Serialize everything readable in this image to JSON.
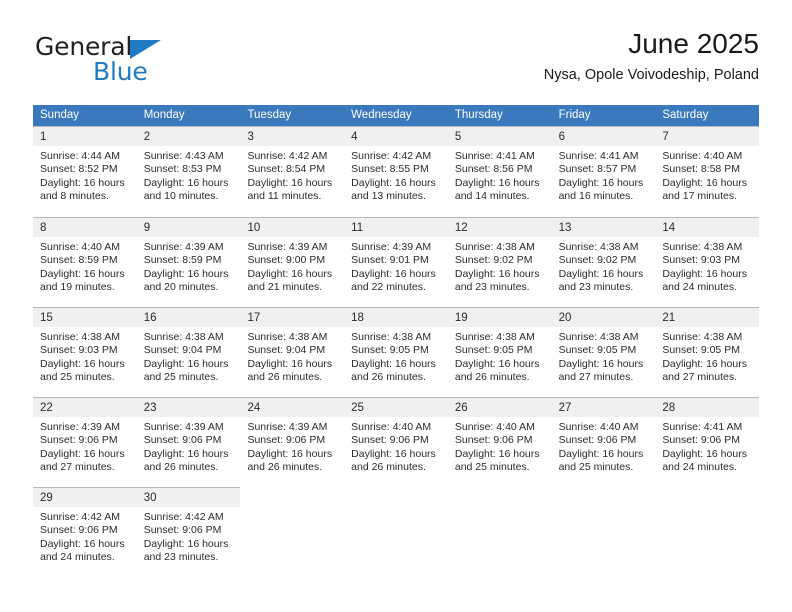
{
  "brand": {
    "name_part1": "General",
    "name_part2": "Blue",
    "triangle_color": "#1f7cc4"
  },
  "header": {
    "title": "June 2025",
    "subtitle": "Nysa, Opole Voivodeship, Poland"
  },
  "theme": {
    "header_blue": "#3a79bd",
    "day_band_gray": "#f0f0f0",
    "grid_line": "#b9b9b9",
    "text": "#2b2b2b"
  },
  "weekdays": [
    "Sunday",
    "Monday",
    "Tuesday",
    "Wednesday",
    "Thursday",
    "Friday",
    "Saturday"
  ],
  "labels": {
    "sunrise_prefix": "Sunrise:",
    "sunset_prefix": "Sunset:",
    "daylight_prefix": "Daylight:"
  },
  "weeks": [
    [
      {
        "day": "1",
        "sunrise": "Sunrise: 4:44 AM",
        "sunset": "Sunset: 8:52 PM",
        "daylight_1": "Daylight: 16 hours",
        "daylight_2": "and 8 minutes."
      },
      {
        "day": "2",
        "sunrise": "Sunrise: 4:43 AM",
        "sunset": "Sunset: 8:53 PM",
        "daylight_1": "Daylight: 16 hours",
        "daylight_2": "and 10 minutes."
      },
      {
        "day": "3",
        "sunrise": "Sunrise: 4:42 AM",
        "sunset": "Sunset: 8:54 PM",
        "daylight_1": "Daylight: 16 hours",
        "daylight_2": "and 11 minutes."
      },
      {
        "day": "4",
        "sunrise": "Sunrise: 4:42 AM",
        "sunset": "Sunset: 8:55 PM",
        "daylight_1": "Daylight: 16 hours",
        "daylight_2": "and 13 minutes."
      },
      {
        "day": "5",
        "sunrise": "Sunrise: 4:41 AM",
        "sunset": "Sunset: 8:56 PM",
        "daylight_1": "Daylight: 16 hours",
        "daylight_2": "and 14 minutes."
      },
      {
        "day": "6",
        "sunrise": "Sunrise: 4:41 AM",
        "sunset": "Sunset: 8:57 PM",
        "daylight_1": "Daylight: 16 hours",
        "daylight_2": "and 16 minutes."
      },
      {
        "day": "7",
        "sunrise": "Sunrise: 4:40 AM",
        "sunset": "Sunset: 8:58 PM",
        "daylight_1": "Daylight: 16 hours",
        "daylight_2": "and 17 minutes."
      }
    ],
    [
      {
        "day": "8",
        "sunrise": "Sunrise: 4:40 AM",
        "sunset": "Sunset: 8:59 PM",
        "daylight_1": "Daylight: 16 hours",
        "daylight_2": "and 19 minutes."
      },
      {
        "day": "9",
        "sunrise": "Sunrise: 4:39 AM",
        "sunset": "Sunset: 8:59 PM",
        "daylight_1": "Daylight: 16 hours",
        "daylight_2": "and 20 minutes."
      },
      {
        "day": "10",
        "sunrise": "Sunrise: 4:39 AM",
        "sunset": "Sunset: 9:00 PM",
        "daylight_1": "Daylight: 16 hours",
        "daylight_2": "and 21 minutes."
      },
      {
        "day": "11",
        "sunrise": "Sunrise: 4:39 AM",
        "sunset": "Sunset: 9:01 PM",
        "daylight_1": "Daylight: 16 hours",
        "daylight_2": "and 22 minutes."
      },
      {
        "day": "12",
        "sunrise": "Sunrise: 4:38 AM",
        "sunset": "Sunset: 9:02 PM",
        "daylight_1": "Daylight: 16 hours",
        "daylight_2": "and 23 minutes."
      },
      {
        "day": "13",
        "sunrise": "Sunrise: 4:38 AM",
        "sunset": "Sunset: 9:02 PM",
        "daylight_1": "Daylight: 16 hours",
        "daylight_2": "and 23 minutes."
      },
      {
        "day": "14",
        "sunrise": "Sunrise: 4:38 AM",
        "sunset": "Sunset: 9:03 PM",
        "daylight_1": "Daylight: 16 hours",
        "daylight_2": "and 24 minutes."
      }
    ],
    [
      {
        "day": "15",
        "sunrise": "Sunrise: 4:38 AM",
        "sunset": "Sunset: 9:03 PM",
        "daylight_1": "Daylight: 16 hours",
        "daylight_2": "and 25 minutes."
      },
      {
        "day": "16",
        "sunrise": "Sunrise: 4:38 AM",
        "sunset": "Sunset: 9:04 PM",
        "daylight_1": "Daylight: 16 hours",
        "daylight_2": "and 25 minutes."
      },
      {
        "day": "17",
        "sunrise": "Sunrise: 4:38 AM",
        "sunset": "Sunset: 9:04 PM",
        "daylight_1": "Daylight: 16 hours",
        "daylight_2": "and 26 minutes."
      },
      {
        "day": "18",
        "sunrise": "Sunrise: 4:38 AM",
        "sunset": "Sunset: 9:05 PM",
        "daylight_1": "Daylight: 16 hours",
        "daylight_2": "and 26 minutes."
      },
      {
        "day": "19",
        "sunrise": "Sunrise: 4:38 AM",
        "sunset": "Sunset: 9:05 PM",
        "daylight_1": "Daylight: 16 hours",
        "daylight_2": "and 26 minutes."
      },
      {
        "day": "20",
        "sunrise": "Sunrise: 4:38 AM",
        "sunset": "Sunset: 9:05 PM",
        "daylight_1": "Daylight: 16 hours",
        "daylight_2": "and 27 minutes."
      },
      {
        "day": "21",
        "sunrise": "Sunrise: 4:38 AM",
        "sunset": "Sunset: 9:05 PM",
        "daylight_1": "Daylight: 16 hours",
        "daylight_2": "and 27 minutes."
      }
    ],
    [
      {
        "day": "22",
        "sunrise": "Sunrise: 4:39 AM",
        "sunset": "Sunset: 9:06 PM",
        "daylight_1": "Daylight: 16 hours",
        "daylight_2": "and 27 minutes."
      },
      {
        "day": "23",
        "sunrise": "Sunrise: 4:39 AM",
        "sunset": "Sunset: 9:06 PM",
        "daylight_1": "Daylight: 16 hours",
        "daylight_2": "and 26 minutes."
      },
      {
        "day": "24",
        "sunrise": "Sunrise: 4:39 AM",
        "sunset": "Sunset: 9:06 PM",
        "daylight_1": "Daylight: 16 hours",
        "daylight_2": "and 26 minutes."
      },
      {
        "day": "25",
        "sunrise": "Sunrise: 4:40 AM",
        "sunset": "Sunset: 9:06 PM",
        "daylight_1": "Daylight: 16 hours",
        "daylight_2": "and 26 minutes."
      },
      {
        "day": "26",
        "sunrise": "Sunrise: 4:40 AM",
        "sunset": "Sunset: 9:06 PM",
        "daylight_1": "Daylight: 16 hours",
        "daylight_2": "and 25 minutes."
      },
      {
        "day": "27",
        "sunrise": "Sunrise: 4:40 AM",
        "sunset": "Sunset: 9:06 PM",
        "daylight_1": "Daylight: 16 hours",
        "daylight_2": "and 25 minutes."
      },
      {
        "day": "28",
        "sunrise": "Sunrise: 4:41 AM",
        "sunset": "Sunset: 9:06 PM",
        "daylight_1": "Daylight: 16 hours",
        "daylight_2": "and 24 minutes."
      }
    ],
    [
      {
        "day": "29",
        "sunrise": "Sunrise: 4:42 AM",
        "sunset": "Sunset: 9:06 PM",
        "daylight_1": "Daylight: 16 hours",
        "daylight_2": "and 24 minutes."
      },
      {
        "day": "30",
        "sunrise": "Sunrise: 4:42 AM",
        "sunset": "Sunset: 9:06 PM",
        "daylight_1": "Daylight: 16 hours",
        "daylight_2": "and 23 minutes."
      },
      {
        "day": "",
        "sunrise": "",
        "sunset": "",
        "daylight_1": "",
        "daylight_2": ""
      },
      {
        "day": "",
        "sunrise": "",
        "sunset": "",
        "daylight_1": "",
        "daylight_2": ""
      },
      {
        "day": "",
        "sunrise": "",
        "sunset": "",
        "daylight_1": "",
        "daylight_2": ""
      },
      {
        "day": "",
        "sunrise": "",
        "sunset": "",
        "daylight_1": "",
        "daylight_2": ""
      },
      {
        "day": "",
        "sunrise": "",
        "sunset": "",
        "daylight_1": "",
        "daylight_2": ""
      }
    ]
  ]
}
